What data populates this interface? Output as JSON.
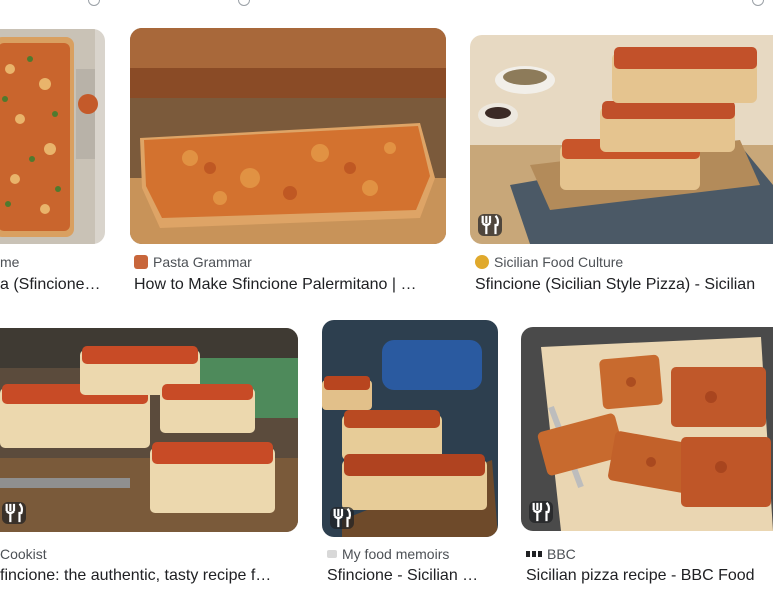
{
  "results": [
    {
      "source": "me",
      "title": "a (Sfincione…",
      "favicon": "site-icon",
      "badge": false
    },
    {
      "source": "Pasta Grammar",
      "title": "How to Make Sfincione Palermitano | …",
      "favicon": "pasta-grammar-icon",
      "badge": false
    },
    {
      "source": "Sicilian Food Culture",
      "title": "Sfincione (Sicilian Style Pizza) - Sicilian",
      "favicon": "sicilian-food-culture-icon",
      "badge": true
    },
    {
      "source": "Cookist",
      "title": "fincione: the authentic, tasty recipe f…",
      "favicon": "cookist-icon",
      "badge": true
    },
    {
      "source": "My food memoirs",
      "title": "Sfincione - Sicilian …",
      "favicon": "my-food-memoirs-icon",
      "badge": true
    },
    {
      "source": "BBC",
      "title": "Sicilian pizza recipe - BBC Food",
      "favicon": "bbc-icon",
      "badge": true
    }
  ],
  "badge_icon": "fork-knife-icon",
  "colors": {
    "title": "#202124",
    "source": "#4d5156",
    "badge_bg": "#202124"
  }
}
